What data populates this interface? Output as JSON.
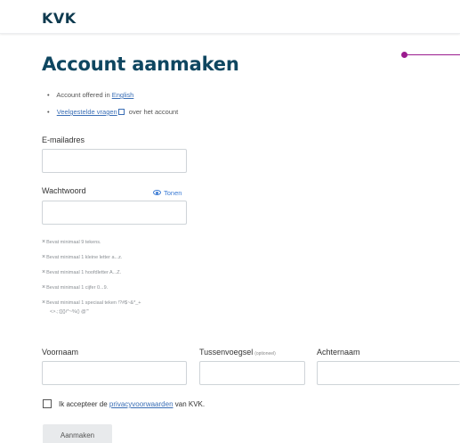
{
  "header": {
    "logo_text": "KVK"
  },
  "page": {
    "title": "Account aanmaken"
  },
  "info": {
    "english_prefix": "Account offered in ",
    "english_link": "English",
    "faq_link": "Veelgestelde vragen",
    "faq_suffix": " over het account"
  },
  "form": {
    "email_label": "E-mailadres",
    "email_value": "",
    "password_label": "Wachtwoord",
    "password_value": "",
    "show_password": "Tonen",
    "requirements": [
      "Bevat minimaal 9 tekens.",
      "Bevat minimaal 1 kleine letter a...z.",
      "Bevat minimaal 1 hoofdletter A...Z.",
      "Bevat minimaal 1 cijfer 0...9.",
      "Bevat minimaal 1 speciaal teken !?#$~&*_+"
    ],
    "requirements_special_cont": "<>.;:[]{}/^~%() @\"'",
    "firstname_label": "Voornaam",
    "middlename_label": "Tussenvoegsel",
    "middlename_optional": "(optioneel)",
    "lastname_label": "Achternaam",
    "consent_prefix": "Ik accepteer de ",
    "consent_link": "privacyvoorwaarden",
    "consent_suffix": " van KVK.",
    "consent_checked": false,
    "submit_label": "Aanmaken"
  },
  "colors": {
    "title": "#0e4660",
    "link": "#3b6fb6",
    "accent_line": "#9b1b8e"
  }
}
